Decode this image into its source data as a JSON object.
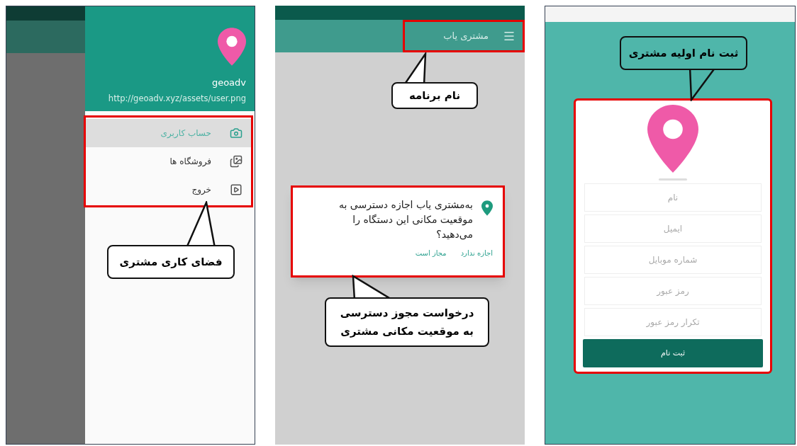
{
  "drawer_screen": {
    "profile_name": "geoadv",
    "profile_url": "http://geoadv.xyz/assets/user.png",
    "menu_items": [
      {
        "label": "حساب کاربری",
        "selected": true
      },
      {
        "label": "فروشگاه ها",
        "selected": false
      },
      {
        "label": "خروج",
        "selected": false
      }
    ],
    "callout": "فضای کاری مشتری"
  },
  "permission_screen": {
    "app_title": "مشتری یاب",
    "title_callout": "نام برنامه",
    "dialog": {
      "message": "به‌مشتری یاب اجازه دسترسی به موقعیت مکانی این دستگاه را می‌دهید؟",
      "buttons": [
        "اجازه ندارد",
        "مجاز است"
      ]
    },
    "dialog_callout": "درخواست مجوز دسترسی به موقعیت مکانی مشتری"
  },
  "signup_screen": {
    "callout": "ثبت نام اولیه مشتری",
    "fields": [
      {
        "placeholder": "نام"
      },
      {
        "placeholder": "ایمیل"
      },
      {
        "placeholder": "شماره موبایل"
      },
      {
        "placeholder": "رمز عبور"
      },
      {
        "placeholder": "تکرار رمز عبور"
      }
    ],
    "submit": "ثبت نام"
  }
}
